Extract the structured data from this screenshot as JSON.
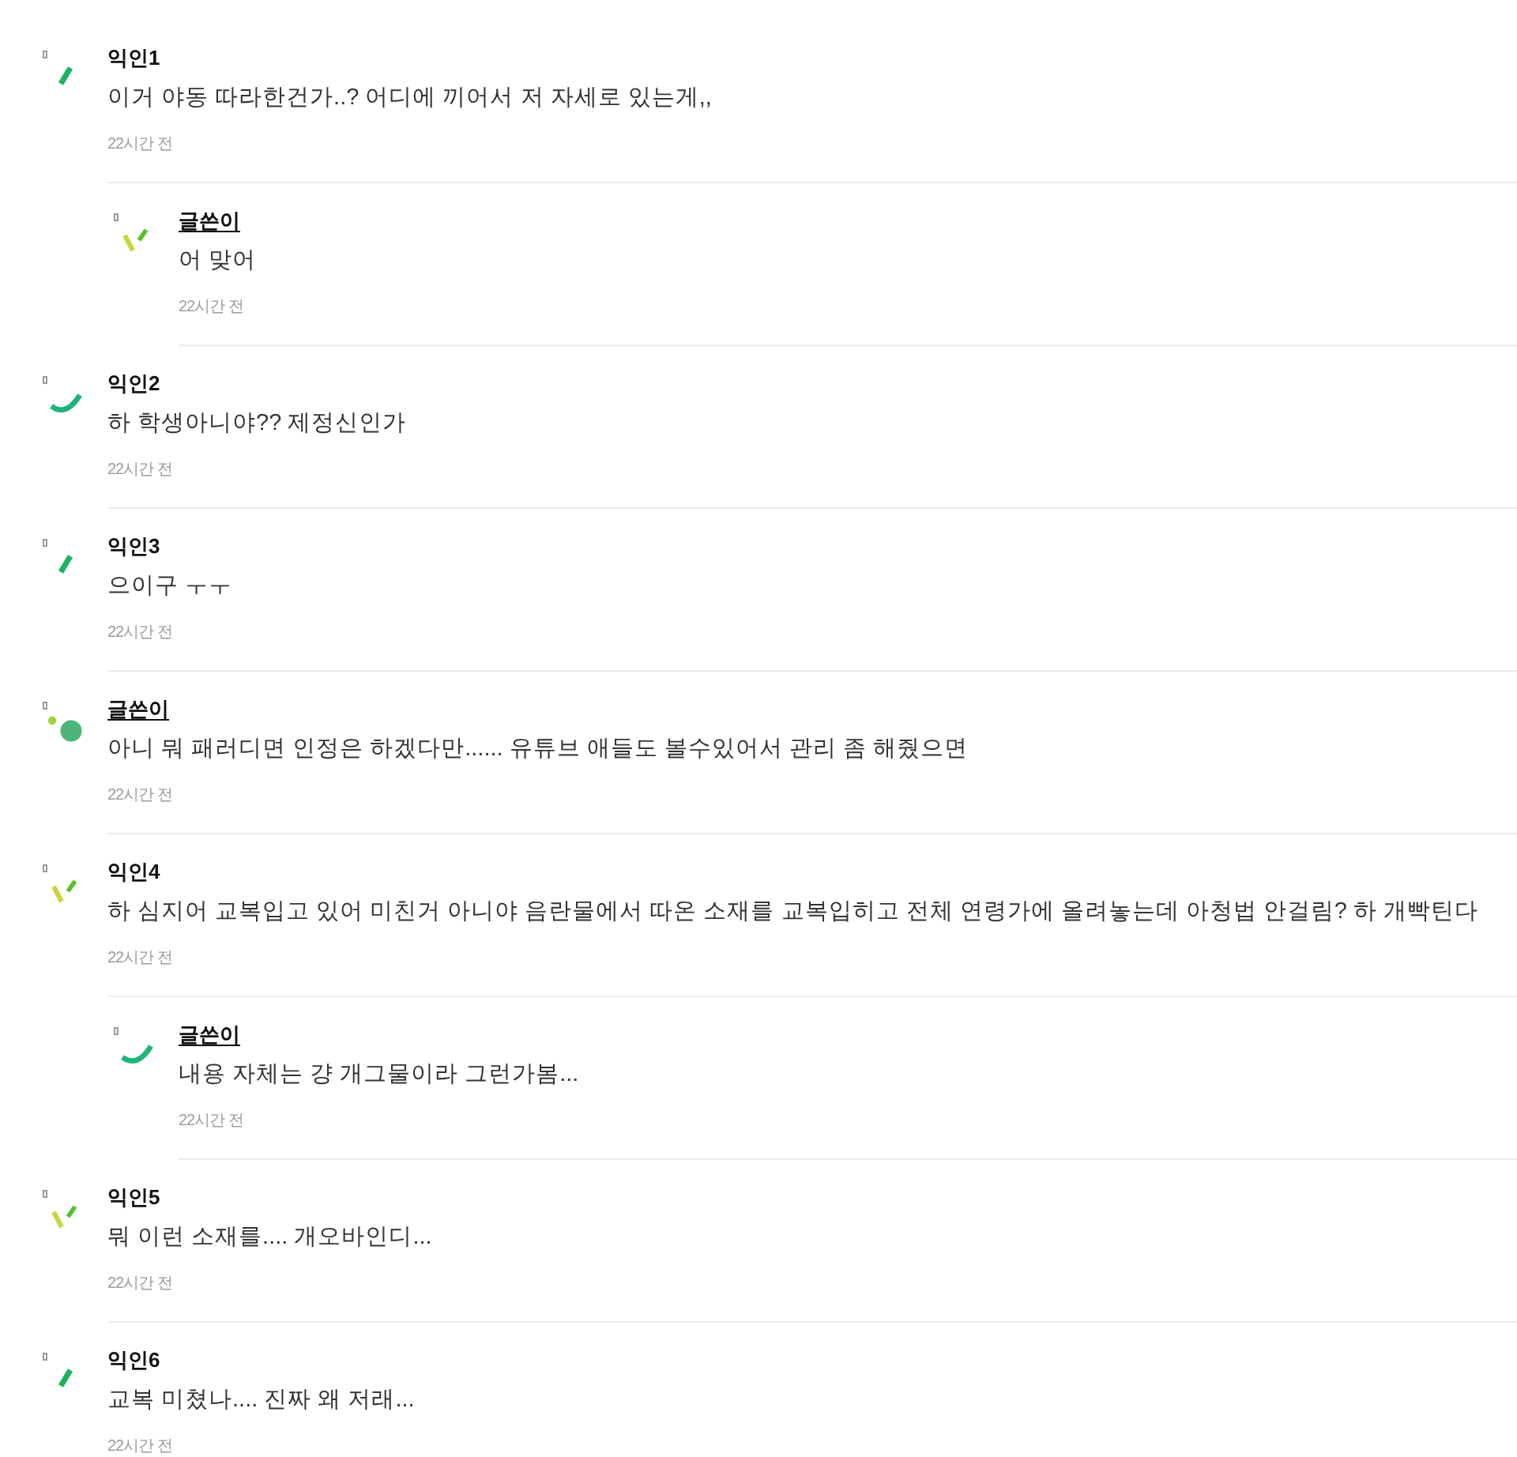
{
  "comments": [
    {
      "name": "익인1",
      "author": false,
      "avatar": {
        "kind": "slash"
      },
      "text": "이거 야동 따라한건가..? 어디에 끼어서 저 자세로 있는게,,",
      "time": "22시간 전",
      "replies": [
        {
          "name": "글쓴이",
          "author": true,
          "avatar": {
            "kind": "ticks"
          },
          "text": "어 맞어",
          "time": "22시간 전"
        }
      ]
    },
    {
      "name": "익인2",
      "author": false,
      "avatar": {
        "kind": "arc"
      },
      "text": "하 학생아니야?? 제정신인가",
      "time": "22시간 전"
    },
    {
      "name": "익인3",
      "author": false,
      "avatar": {
        "kind": "slash"
      },
      "text": "으이구 ㅜㅜ",
      "time": "22시간 전"
    },
    {
      "name": "글쓴이",
      "author": true,
      "avatar": {
        "kind": "dots"
      },
      "text": "아니 뭐 패러디면 인정은 하겠다만...... 유튜브 애들도 볼수있어서 관리 좀 해줬으면",
      "time": "22시간 전"
    },
    {
      "name": "익인4",
      "author": false,
      "avatar": {
        "kind": "ticks"
      },
      "text": "하 심지어 교복입고 있어 미친거 아니야 음란물에서 따온 소재를 교복입히고 전체 연령가에 올려놓는데 아청법 안걸림? 하 개빡틴다",
      "time": "22시간 전",
      "replies": [
        {
          "name": "글쓴이",
          "author": true,
          "avatar": {
            "kind": "arc"
          },
          "text": "내용 자체는 걍 개그물이라 그런가봄...",
          "time": "22시간 전"
        }
      ]
    },
    {
      "name": "익인5",
      "author": false,
      "avatar": {
        "kind": "ticks"
      },
      "text": "뭐 이런 소재를.... 개오바인디...",
      "time": "22시간 전"
    },
    {
      "name": "익인6",
      "author": false,
      "avatar": {
        "kind": "slash"
      },
      "text": "교복 미쳤나.... 진짜 왜 저래...",
      "time": "22시간 전"
    }
  ]
}
